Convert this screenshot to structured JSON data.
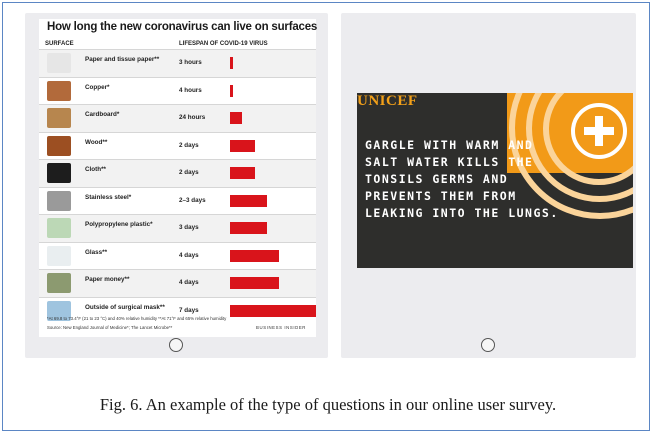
{
  "infographic": {
    "title": "How long the new coronavirus can live on surfaces",
    "col_surface": "SURFACE",
    "col_lifespan": "LIFESPAN OF COVID-19 VIRUS",
    "rows": [
      {
        "label": "Paper and tissue paper**",
        "duration": "3 hours",
        "bar_fraction": 0.03,
        "thumb_color": "#e6e6e6",
        "icon": "tissue-paper-icon"
      },
      {
        "label": "Copper*",
        "duration": "4 hours",
        "bar_fraction": 0.03,
        "thumb_color": "#b26a3b",
        "icon": "copper-icon"
      },
      {
        "label": "Cardboard*",
        "duration": "24 hours",
        "bar_fraction": 0.14,
        "thumb_color": "#b7864e",
        "icon": "cardboard-icon"
      },
      {
        "label": "Wood**",
        "duration": "2 days",
        "bar_fraction": 0.29,
        "thumb_color": "#9c4f22",
        "icon": "wood-icon"
      },
      {
        "label": "Cloth**",
        "duration": "2 days",
        "bar_fraction": 0.29,
        "thumb_color": "#1d1d1d",
        "icon": "cloth-icon"
      },
      {
        "label": "Stainless steel*",
        "duration": "2–3 days",
        "bar_fraction": 0.43,
        "thumb_color": "#9a9a9a",
        "icon": "steel-pot-icon"
      },
      {
        "label": "Polypropylene plastic*",
        "duration": "3 days",
        "bar_fraction": 0.43,
        "thumb_color": "#bcd8b6",
        "icon": "plastic-container-icon"
      },
      {
        "label": "Glass**",
        "duration": "4 days",
        "bar_fraction": 0.57,
        "thumb_color": "#e9eef0",
        "icon": "glass-icon"
      },
      {
        "label": "Paper money**",
        "duration": "4 days",
        "bar_fraction": 0.57,
        "thumb_color": "#8c9a70",
        "icon": "banknote-icon"
      },
      {
        "label": "Outside of surgical mask**",
        "duration": "7 days",
        "bar_fraction": 1.0,
        "thumb_color": "#9fc4df",
        "icon": "surgical-mask-icon"
      }
    ],
    "footnote": "*At 69.8 to 73.4°F (21 to 23 °C) and 40% relative humidity        **At 71°F and 65% relative humidity",
    "source": "Source: New England Journal of Medicine*; The Lancet Microbe**",
    "brand": "BUSINESS INSIDER"
  },
  "unicef": {
    "brand": "UNICEF",
    "message": "GARGLE WITH WARM AND SALT WATER KILLS THE TONSILS GERMS AND PREVENTS THEM FROM LEAKING INTO THE LUNGS.",
    "orange": "#f29a18",
    "dark": "#2e2e2c"
  },
  "caption": "Fig. 6. An example of the type of questions in our online user survey."
}
